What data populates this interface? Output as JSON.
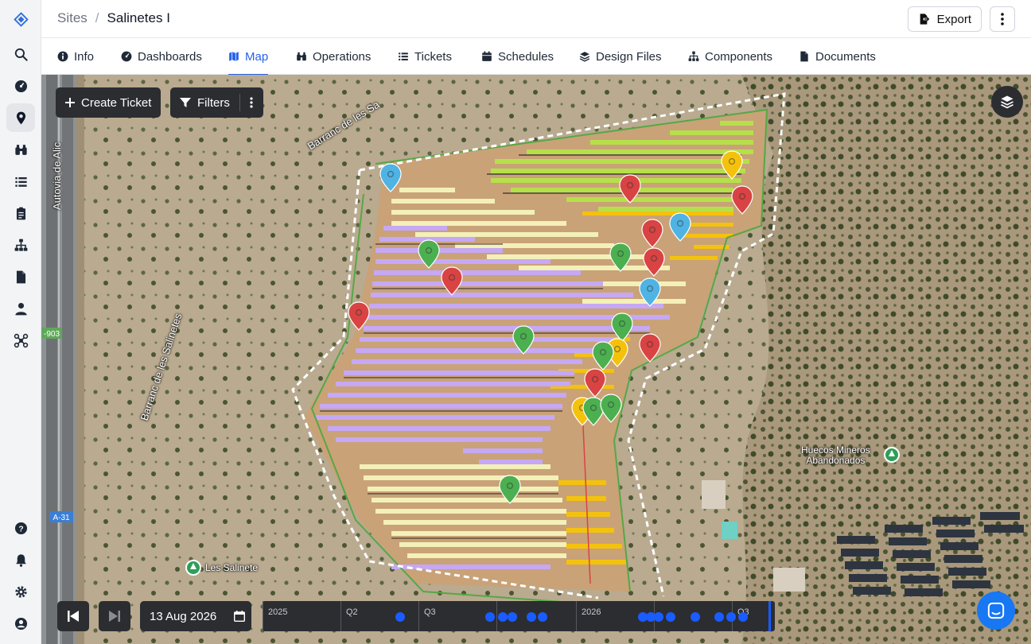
{
  "breadcrumb": {
    "parent": "Sites",
    "separator": "/",
    "current": "Salinetes I"
  },
  "header": {
    "export_label": "Export"
  },
  "tabs": [
    {
      "label": "Info",
      "icon": "info-icon"
    },
    {
      "label": "Dashboards",
      "icon": "dashboard-icon"
    },
    {
      "label": "Map",
      "icon": "map-icon",
      "active": true
    },
    {
      "label": "Operations",
      "icon": "binoculars-icon"
    },
    {
      "label": "Tickets",
      "icon": "list-icon"
    },
    {
      "label": "Schedules",
      "icon": "calendar-icon"
    },
    {
      "label": "Design Files",
      "icon": "layers-icon"
    },
    {
      "label": "Components",
      "icon": "sitemap-icon"
    },
    {
      "label": "Documents",
      "icon": "document-icon"
    }
  ],
  "map": {
    "create_ticket_label": "Create Ticket",
    "filters_label": "Filters",
    "labels": {
      "road_1": "Autovia de Alic",
      "road_2": "Barranc de les Sa",
      "road_3": "Barranc de les Salinetes",
      "road_badge_1": "-903",
      "road_badge_2": "A-31",
      "poi_1": "Huecos Mineros",
      "poi_1b": "Abandonados",
      "poi_2": "Les Salinete"
    },
    "colors": {
      "red": "#d94343",
      "green": "#4caf50",
      "yellow": "#f4c20d",
      "blue": "#4fb3e3",
      "purple": "#c6a8f5",
      "lime": "#b6e04a",
      "pale": "#f3f0b8"
    }
  },
  "timeline": {
    "date": "13 Aug 2026",
    "segments": [
      "2025",
      "Q2",
      "Q3",
      "",
      "2026",
      "",
      "",
      "Q3"
    ]
  }
}
